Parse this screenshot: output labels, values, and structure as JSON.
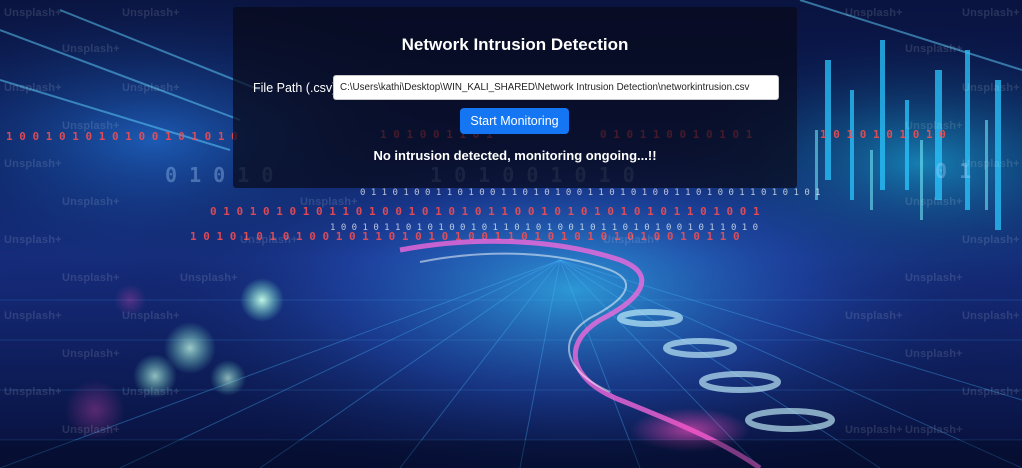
{
  "app": {
    "title": "Network Intrusion Detection"
  },
  "form": {
    "file_path_label": "File Path (.csv):",
    "file_path_value": "C:\\Users\\kathi\\Desktop\\WIN_KALI_SHARED\\Network Intrusion Detection\\networkintrusion.csv",
    "start_button_label": "Start Monitoring"
  },
  "status": {
    "message": "No intrusion detected, monitoring ongoing...!!"
  },
  "background": {
    "watermark_text": "Unsplash+"
  },
  "colors": {
    "accent_button": "#1476f2",
    "panel_bg": "#080a1a",
    "text": "#ffffff"
  }
}
